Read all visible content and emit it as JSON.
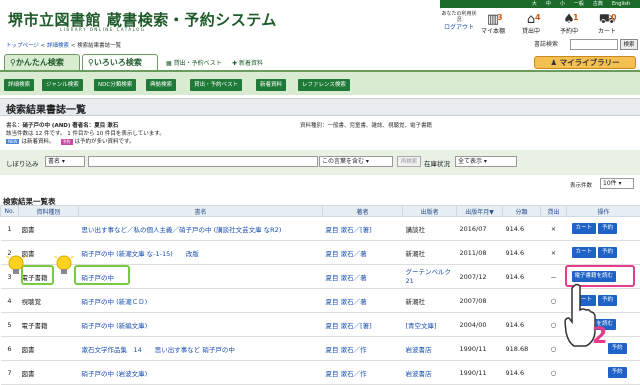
{
  "header": {
    "top_links": [
      "大",
      "中",
      "小",
      "一般",
      "古典",
      "English"
    ],
    "logo_text": "堺市立図書館 蔵書検索・予約システム",
    "logo_sub": "LIBRARY ONLINE CATALOG",
    "user_status": "あなたの利用状況",
    "logout": "ログアウト",
    "icons": [
      {
        "name": "my-shelf-icon",
        "label": "マイ本棚",
        "count": "3"
      },
      {
        "name": "borrowed-icon",
        "label": "貸出中",
        "count": "4"
      },
      {
        "name": "reserved-icon",
        "label": "予約中",
        "count": "1"
      },
      {
        "name": "cart-icon",
        "label": "カート",
        "count": "0"
      }
    ]
  },
  "breadcrumb": {
    "home": "トップページ",
    "detail": "詳細検索",
    "current": "検索結果書誌一覧"
  },
  "quick_search": {
    "label": "書誌検索",
    "button": "検索"
  },
  "tabs": {
    "simple": "かんたん検索",
    "various": "いろいろ検索",
    "best": "貸出・予約ベスト",
    "new": "新着資料",
    "mylibrary": "マイライブラリー"
  },
  "subnav": [
    "詳細検索",
    "ジャンル検索",
    "NDC分類検索",
    "典拠検索",
    "貸出・予約ベスト",
    "新着資料",
    "レファレンス検索"
  ],
  "page_title": "検索結果書誌一覧",
  "condition": {
    "label": "書名：",
    "value": "硝子戸の中 (AND) 著者名：夏目 漱石",
    "sort_label": "資料種別：",
    "sort_value": "一般書、児童書、雑誌、視聴覚、電子書籍"
  },
  "count_line": "該当件数は 12 件です。 1 件目から 10 件目を表示しています。",
  "legend": {
    "new_badge": "NEW",
    "new_text": "は新着資料。",
    "res_badge": "予約",
    "res_text": "は予約が多い資料です。"
  },
  "filter": {
    "label": "しぼり込み",
    "field": "書名",
    "match": "この言葉を含む",
    "button": "再検索",
    "stock_label": "在庫状況",
    "stock_value": "全て表示"
  },
  "per_page": {
    "label": "表示件数",
    "value": "10件"
  },
  "list_title": "検索結果一覧表",
  "columns": [
    "No.",
    "資料種別",
    "書名",
    "著者",
    "出版者",
    "出版年月▼",
    "分類",
    "貸出",
    "操作"
  ],
  "rows": [
    {
      "no": "1",
      "type": "図書",
      "title": "思い出す事など／私の個人主義／硝子戸の中 (講談社文芸文庫 なR2)",
      "author": "夏目 漱石／[著]",
      "publisher": "講談社",
      "date": "2016/07",
      "cls": "914.6",
      "avail": "×",
      "ops": [
        "カート",
        "予約"
      ]
    },
    {
      "no": "2",
      "type": "図書",
      "title": "硝子戸の中 (新潮文庫 な-1-15)　　改版",
      "author": "夏目 漱石／著",
      "publisher": "新潮社",
      "date": "2011/08",
      "cls": "914.6",
      "avail": "×",
      "ops": [
        "カート",
        "予約"
      ]
    },
    {
      "no": "3",
      "type": "電子書籍",
      "title": "硝子戸の中",
      "author": "夏目 漱石／著",
      "publisher": "グーテンベルク21",
      "date": "2007/12",
      "cls": "914.6",
      "avail": "－",
      "ops": [
        "電子書籍を読む"
      ]
    },
    {
      "no": "4",
      "type": "視聴覚",
      "title": "硝子戸の中 (新潮ＣＤ)",
      "author": "夏目 漱石／著",
      "publisher": "新潮社",
      "date": "2007/08",
      "cls": "",
      "avail": "○",
      "ops": [
        "カート",
        "予約"
      ]
    },
    {
      "no": "5",
      "type": "電子書籍",
      "title": "硝子戸の中 (新編文庫)",
      "author": "夏目 漱石／[著]",
      "publisher": "[青空文庫]",
      "date": "2004/00",
      "cls": "914.6",
      "avail": "○",
      "ops": [
        "電子書籍を読む"
      ]
    },
    {
      "no": "6",
      "type": "図書",
      "title": "漱石文学作品集　14　　思い出す事など 硝子戸の中",
      "author": "夏目 漱石／作",
      "publisher": "岩波書店",
      "date": "1990/11",
      "cls": "918.68",
      "avail": "○",
      "ops": [
        "予約"
      ]
    },
    {
      "no": "7",
      "type": "図書",
      "title": "硝子戸の中 (岩波文庫)",
      "author": "夏目 漱石／作",
      "publisher": "岩波書店",
      "date": "1990/11",
      "cls": "914.6",
      "avail": "○",
      "ops": [
        "予約"
      ]
    }
  ],
  "annotation": {
    "step": "2"
  }
}
